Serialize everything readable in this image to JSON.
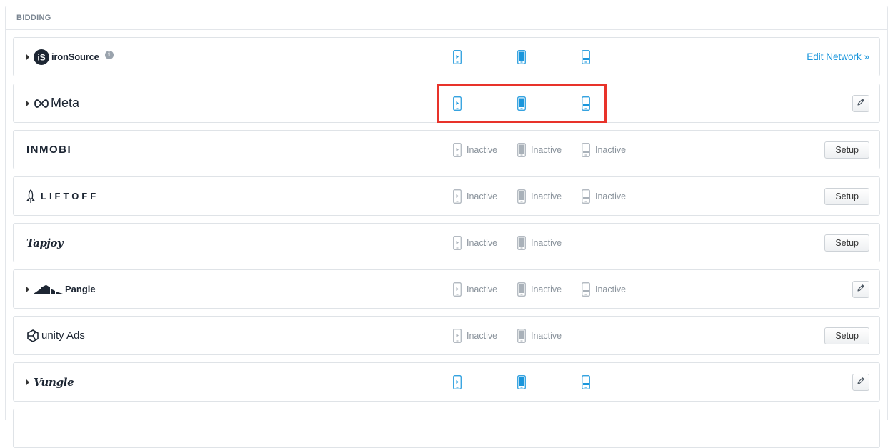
{
  "panel": {
    "title": "BIDDING"
  },
  "colors": {
    "active": "#1a96dc",
    "inactive": "#a9b1b9",
    "highlight": "#e8332a"
  },
  "networks": [
    {
      "id": "ironsource",
      "name": "ironSource",
      "expandable": true,
      "info": true,
      "formats": [
        "active",
        "active",
        "active"
      ],
      "action": "link",
      "action_label": "Edit Network »"
    },
    {
      "id": "meta",
      "name": "Meta",
      "expandable": true,
      "formats": [
        "active",
        "active",
        "active"
      ],
      "action": "edit"
    },
    {
      "id": "inmobi",
      "name": "INMOBI",
      "formats": [
        "inactive",
        "inactive",
        "inactive"
      ],
      "action": "setup",
      "action_label": "Setup"
    },
    {
      "id": "liftoff",
      "name": "LIFTOFF",
      "formats": [
        "inactive",
        "inactive",
        "inactive"
      ],
      "action": "setup",
      "action_label": "Setup"
    },
    {
      "id": "tapjoy",
      "name": "Tapjoy",
      "formats": [
        "inactive",
        "inactive"
      ],
      "action": "setup",
      "action_label": "Setup"
    },
    {
      "id": "pangle",
      "name": "Pangle",
      "expandable": true,
      "formats": [
        "inactive",
        "inactive",
        "inactive"
      ],
      "action": "edit"
    },
    {
      "id": "unity",
      "name": "unity Ads",
      "formats": [
        "inactive",
        "inactive"
      ],
      "action": "setup",
      "action_label": "Setup"
    },
    {
      "id": "vungle",
      "name": "Vungle",
      "expandable": true,
      "formats": [
        "active",
        "active",
        "active"
      ],
      "action": "edit"
    }
  ],
  "format_labels": {
    "inactive": "Inactive"
  },
  "format_icons": [
    "rewarded-video-icon",
    "interstitial-icon",
    "banner-icon"
  ]
}
